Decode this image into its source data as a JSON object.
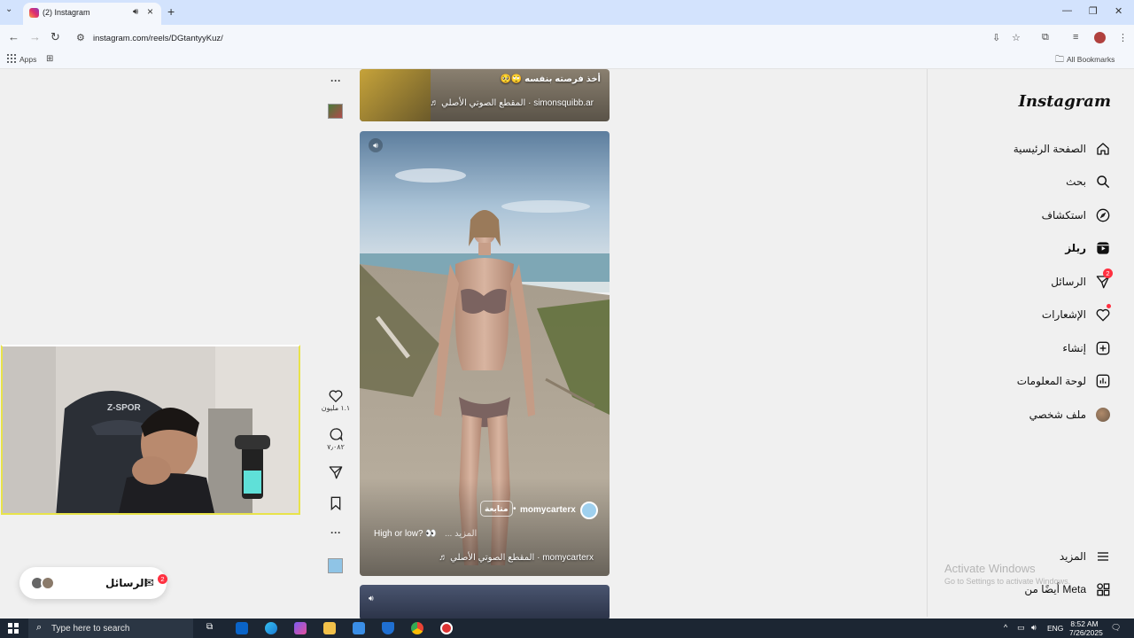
{
  "browser": {
    "tab_title": "(2) Instagram",
    "url": "instagram.com/reels/DGtantyyKuz/",
    "bookmarks_apps": "Apps",
    "all_bookmarks": "All Bookmarks"
  },
  "sidebar": {
    "logo": "Instagram",
    "items": [
      {
        "label": "الصفحة الرئيسية",
        "icon": "home-icon"
      },
      {
        "label": "بحث",
        "icon": "search-icon"
      },
      {
        "label": "استكشاف",
        "icon": "compass-icon"
      },
      {
        "label": "ريلز",
        "icon": "reels-icon"
      },
      {
        "label": "الرسائل",
        "icon": "send-icon",
        "badge": "2"
      },
      {
        "label": "الإشعارات",
        "icon": "heart-icon"
      },
      {
        "label": "إنشاء",
        "icon": "plus-square-icon"
      },
      {
        "label": "لوحة المعلومات",
        "icon": "dashboard-icon"
      },
      {
        "label": "ملف شخصي",
        "icon": "profile-avatar"
      }
    ],
    "more": "المزيد",
    "meta": "أيضًا من Meta"
  },
  "reels": {
    "top": {
      "caption": "أخذ فرصته بنفسه 🙄🥺",
      "audio": "simonsquibb.ar · المقطع الصوتي الأصلي ♬"
    },
    "main": {
      "username": "momycarterx",
      "follow": "متابعة",
      "caption": "High or low? 👀",
      "more": "... المزيد",
      "audio": "momycarterx · المقطع الصوتي الأصلي ♬",
      "likes": "١.١ مليون",
      "comments": "٧٫٠٨٢"
    }
  },
  "messages_pill": {
    "label": "الرسائل",
    "badge": "2"
  },
  "watermark": {
    "line1": "Activate Windows",
    "line2": "Go to Settings to activate Windows."
  },
  "taskbar": {
    "search_placeholder": "Type here to search",
    "lang": "ENG",
    "time": "8:52 AM",
    "date": "7/26/2025"
  }
}
